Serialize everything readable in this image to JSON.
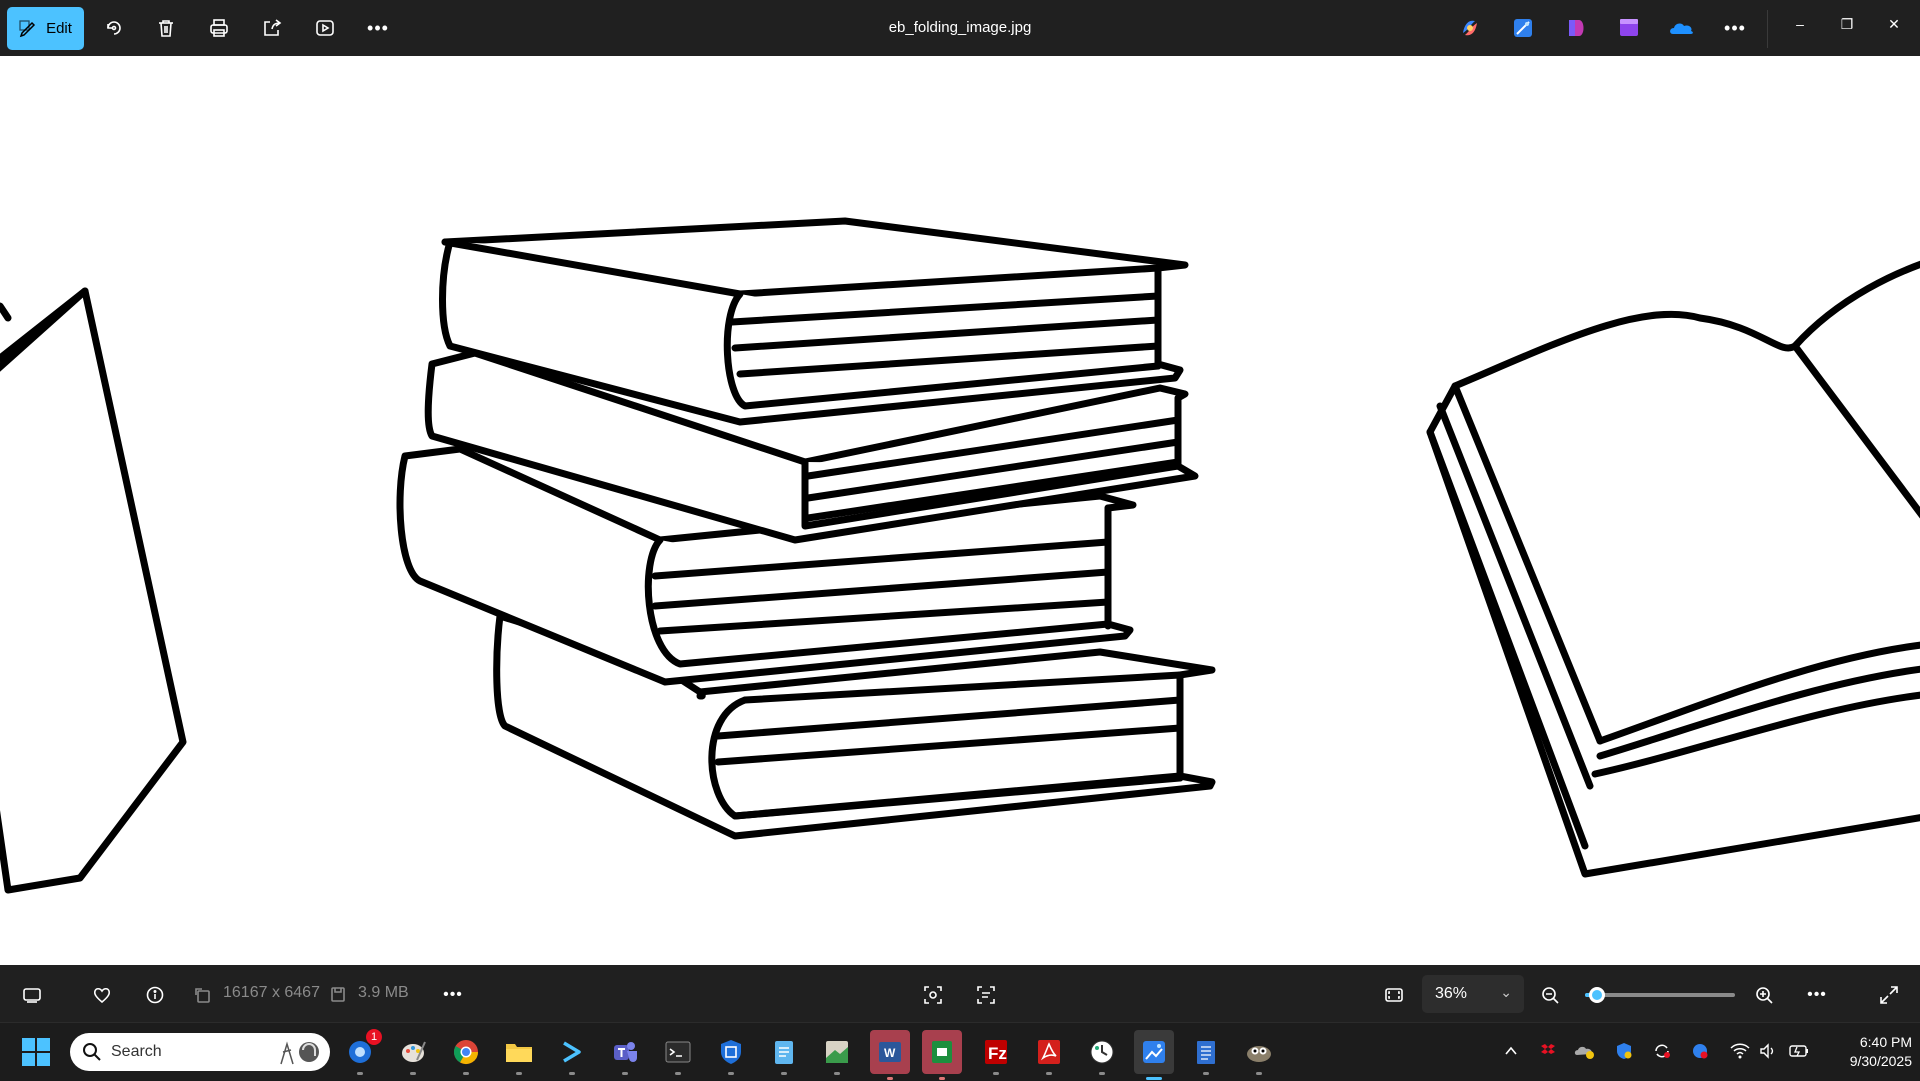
{
  "title_bar": {
    "edit_label": "Edit",
    "filename": "eb_folding_image.jpg",
    "toolbar_icons": [
      "rotate-icon",
      "delete-icon",
      "print-icon",
      "share-icon",
      "slideshow-icon",
      "more-icon"
    ],
    "app_icons": [
      "copilot-icon",
      "photos-editor-icon",
      "designer-icon",
      "clipchamp-icon",
      "onedrive-icon",
      "more-icon"
    ],
    "window_controls": {
      "minimize": "–",
      "restore": "❐",
      "close": "✕"
    }
  },
  "bottom_bar": {
    "dimensions": "16167 x 6467",
    "file_size": "3.9 MB",
    "zoom": "36%",
    "zoom_level_fraction": 0.08,
    "more_label": "•••"
  },
  "taskbar": {
    "search_placeholder": "Search",
    "mail_badge": "1",
    "time": "6:40 PM",
    "date": "9/30/2025",
    "apps": [
      "outlook",
      "paint",
      "chrome",
      "file-explorer",
      "powershell",
      "teams",
      "terminal",
      "defender",
      "notepad",
      "sheets",
      "word",
      "excel",
      "filezilla",
      "acrobat",
      "clock",
      "photos",
      "notepad-plus",
      "gimp"
    ]
  },
  "colors": {
    "accent": "#4cc2ff",
    "titlebar": "#202020",
    "canvas": "#ffffff"
  }
}
